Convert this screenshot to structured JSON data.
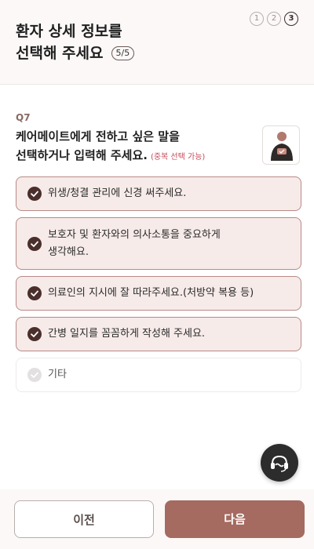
{
  "header": {
    "title_line1": "환자 상세 정보를",
    "title_line2": "선택해 주세요",
    "count": "5/5",
    "steps": [
      "1",
      "2",
      "3"
    ],
    "active_step": "3"
  },
  "question": {
    "number": "Q7",
    "text_line1": "케어메이트에게 전하고 싶은 말을",
    "text_line2": "선택하거나 입력해 주세요.",
    "hint": "(중복 선택 가능)",
    "icon": "caregiver-icon"
  },
  "options": [
    {
      "label": "위생/청결 관리에 신경 써주세요.",
      "selected": true
    },
    {
      "label_line1": "보호자 및 환자와의 의사소통을 중요하게",
      "label_line2": "생각해요.",
      "selected": true
    },
    {
      "label": "의료인의 지시에 잘 따라주세요.(처방약 복용 등)",
      "selected": true
    },
    {
      "label": "간병 일지를 꼼꼼하게 작성해 주세요.",
      "selected": true
    },
    {
      "label": "기타",
      "selected": false
    }
  ],
  "chat_button": {
    "icon": "headset-chat-icon"
  },
  "footer": {
    "prev_label": "이전",
    "next_label": "다음"
  },
  "colors": {
    "accent": "#a56a60",
    "selected_bg": "#f6ebe9",
    "selected_border": "#b98a86",
    "check_fill": "#4a2f2c",
    "hint": "#c44b5a"
  }
}
